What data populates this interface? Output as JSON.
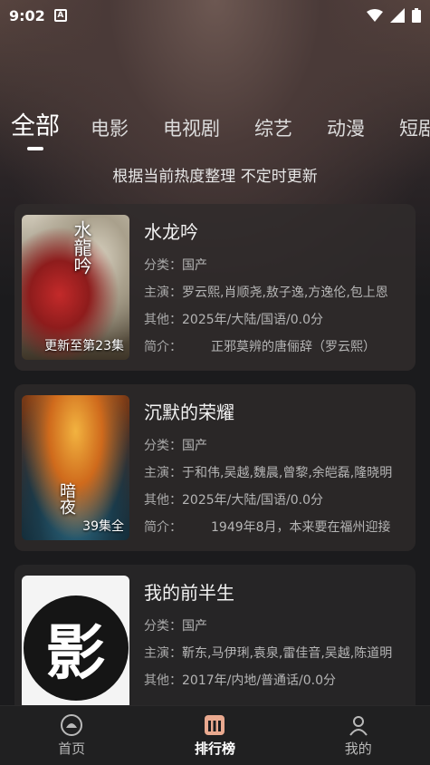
{
  "status_bar": {
    "time": "9:02",
    "badge": "A"
  },
  "tabs": [
    {
      "label": "全部",
      "active": true
    },
    {
      "label": "电影"
    },
    {
      "label": "电视剧"
    },
    {
      "label": "综艺"
    },
    {
      "label": "动漫"
    },
    {
      "label": "短剧"
    }
  ],
  "subtitle": "根据当前热度整理 不定时更新",
  "labels": {
    "category": "分类：",
    "cast": "主演：",
    "other": "其他：",
    "intro": "简介："
  },
  "items": [
    {
      "title": "水龙吟",
      "category": "国产",
      "cast": "罗云熙,肖顺尧,敖子逸,方逸伦,包上恩",
      "other": "2025年/大陆/国语/0.0分",
      "intro": "正邪莫辨的唐俪辞（罗云熙）",
      "tag": "更新至第23集",
      "poster_glyph": "水龍吟"
    },
    {
      "title": "沉默的荣耀",
      "category": "国产",
      "cast": "于和伟,吴越,魏晨,曾黎,余皑磊,隆晓明",
      "other": "2025年/大陆/国语/0.0分",
      "intro": "1949年8月，本来要在福州迎接",
      "tag": "39集全",
      "poster_glyph": "暗夜"
    },
    {
      "title": "我的前半生",
      "category": "国产",
      "cast": "靳东,马伊琍,袁泉,雷佳音,吴越,陈道明",
      "other": "2017年/内地/普通话/0.0分",
      "intro": "",
      "tag": "",
      "poster_glyph": "影"
    }
  ],
  "bottom_nav": [
    {
      "label": "首页",
      "icon": "home-icon",
      "active": false
    },
    {
      "label": "排行榜",
      "icon": "ranking-icon",
      "active": true
    },
    {
      "label": "我的",
      "icon": "profile-icon",
      "active": false
    }
  ],
  "colors": {
    "background": "#1b1b1d",
    "card": "#2a2727",
    "accent": "#ffffff"
  }
}
